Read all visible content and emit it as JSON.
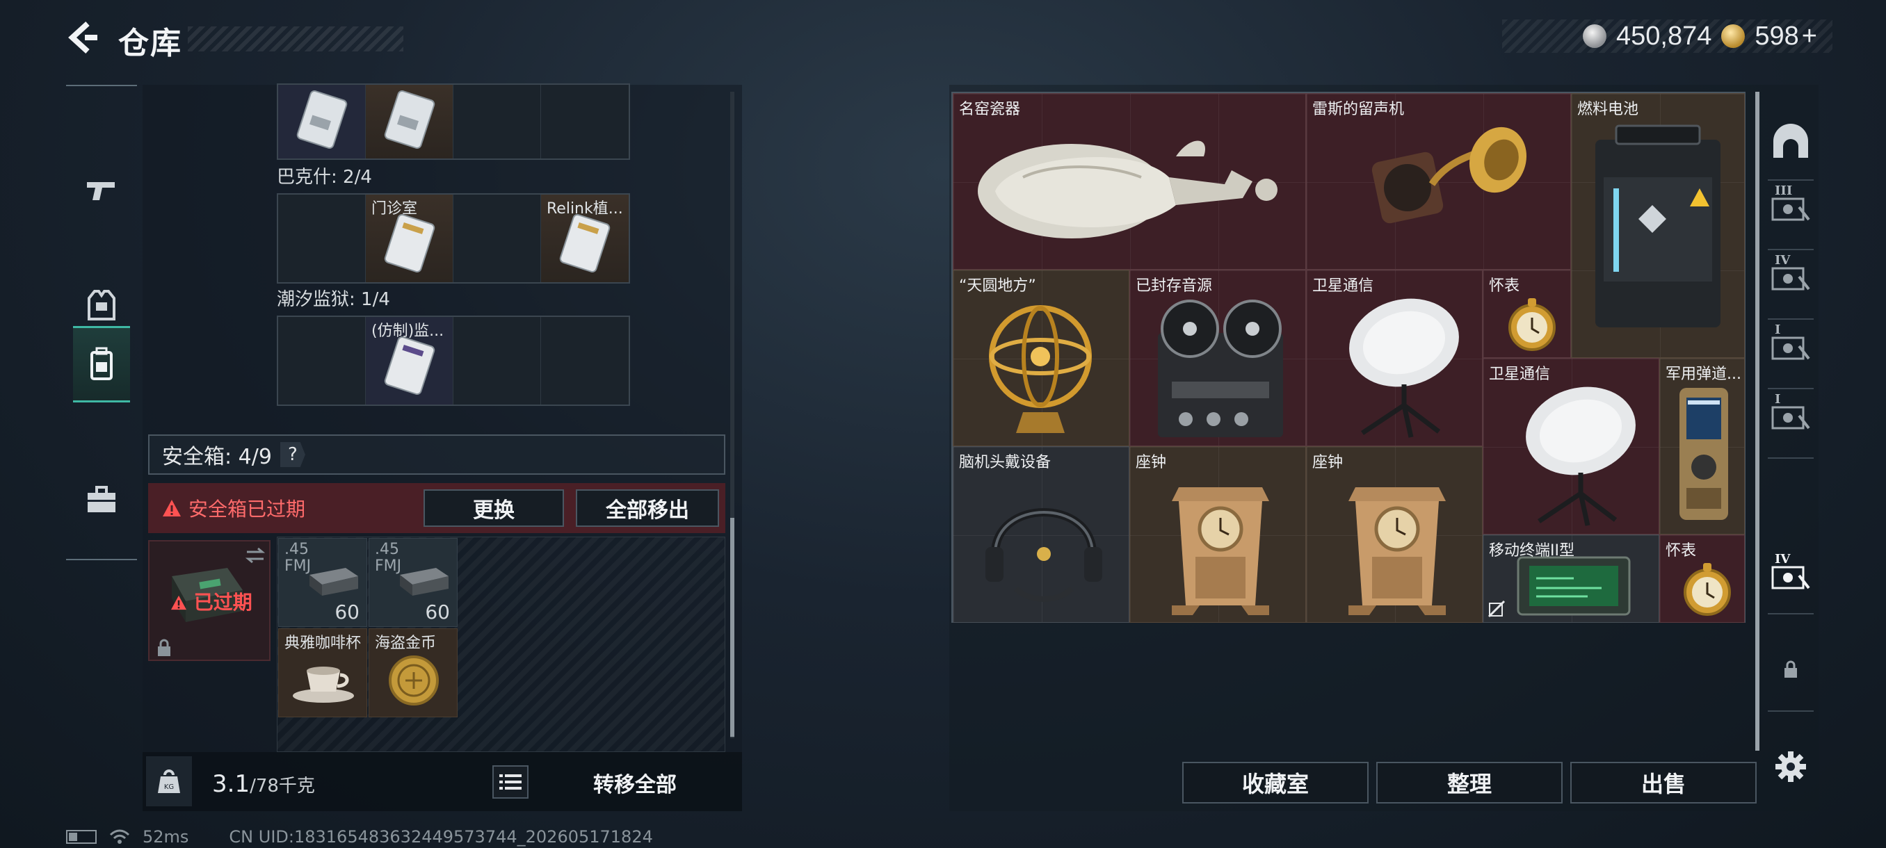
{
  "header": {
    "title": "仓库",
    "currency_silver": "450,874",
    "currency_gold": "598",
    "currency_gold_plus": "+"
  },
  "left_rail": {
    "icons": [
      "gun-icon",
      "vest-icon",
      "backpack-icon",
      "briefcase-icon"
    ],
    "active": "backpack-icon"
  },
  "keycards": {
    "row0": {
      "cells": [
        "",
        "",
        "",
        ""
      ]
    },
    "section1": {
      "label": "巴克什: 2/4",
      "cells": [
        "",
        "门诊室",
        "",
        "Relink植..."
      ]
    },
    "section2": {
      "label": "潮汐监狱: 1/4",
      "cells": [
        "",
        "(仿制)监...",
        "",
        ""
      ]
    }
  },
  "safebox": {
    "label": "安全箱: 4/9",
    "help": "?",
    "expired_msg": "安全箱已过期",
    "replace_btn": "更换",
    "move_all_btn": "全部移出",
    "expired_tag": "已过期",
    "items": [
      {
        "caliber_line1": ".45",
        "caliber_line2": "FMJ",
        "count": "60"
      },
      {
        "caliber_line1": ".45",
        "caliber_line2": "FMJ",
        "count": "60"
      },
      {
        "name": "典雅咖啡杯"
      },
      {
        "name": "海盗金币"
      }
    ]
  },
  "weight": {
    "current": "3.1",
    "max": "/78千克"
  },
  "transfer_all": "转移全部",
  "status": {
    "ping": "52ms",
    "uid": "CN UID:18316548363244957374​4_202605171824"
  },
  "stash": {
    "items": [
      {
        "name": "名窑瓷器",
        "icon": "porcelain-vase-icon"
      },
      {
        "name": "雷斯的留声机",
        "icon": "gramophone-icon"
      },
      {
        "name": "燃料电池",
        "icon": "fuel-cell-icon"
      },
      {
        "name": "“天圆地方”",
        "icon": "armillary-sphere-icon"
      },
      {
        "name": "已封存音源",
        "icon": "reel-recorder-icon"
      },
      {
        "name": "卫星通信",
        "icon": "satellite-dish-icon"
      },
      {
        "name": "怀表",
        "icon": "pocket-watch-icon"
      },
      {
        "name": "卫星通信",
        "icon": "satellite-dish-icon"
      },
      {
        "name": "军用弹道...",
        "icon": "ballistic-computer-icon"
      },
      {
        "name": "脑机头戴设备",
        "icon": "headset-icon"
      },
      {
        "name": "座钟",
        "icon": "mantel-clock-icon"
      },
      {
        "name": "座钟",
        "icon": "mantel-clock-icon"
      },
      {
        "name": "移动终端II型",
        "icon": "mobile-terminal-icon"
      },
      {
        "name": "怀表",
        "icon": "pocket-watch-icon"
      }
    ]
  },
  "actions": {
    "collection": "收藏室",
    "sort": "整理",
    "sell": "出售"
  },
  "right_rail": {
    "tiers": [
      "III",
      "IV",
      "I",
      "I",
      "IV"
    ],
    "icons": [
      "helmet-icon",
      "lock-icon",
      "settings-gear-icon"
    ]
  },
  "colors": {
    "red_item_bg": "#3d1f26",
    "brown_item_bg": "#3a3128",
    "accent_teal": "#3fb8a4",
    "warning_red": "#ff5252"
  }
}
